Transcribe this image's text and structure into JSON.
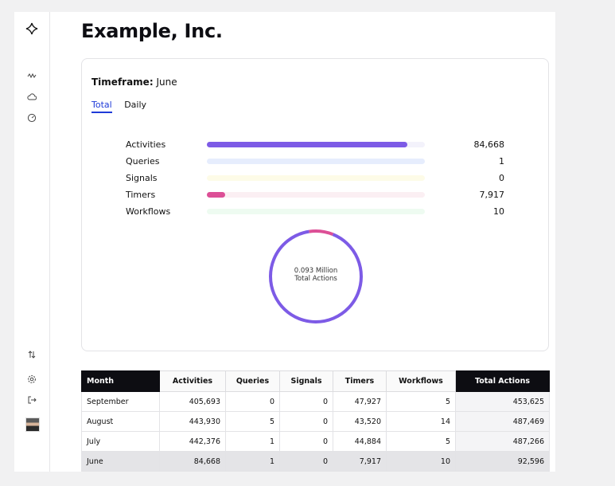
{
  "org": {
    "title": "Example, Inc."
  },
  "sidebar": {
    "icons": [
      "logo-icon",
      "activity-icon",
      "cloud-icon",
      "gauge-icon",
      "sort-icon",
      "settings-icon",
      "logout-icon"
    ]
  },
  "summary": {
    "timeframe_label": "Timeframe:",
    "timeframe_value": "June",
    "tabs": [
      {
        "label": "Total",
        "active": true
      },
      {
        "label": "Daily",
        "active": false
      }
    ],
    "metrics": [
      {
        "label": "Activities",
        "value": "84,668",
        "fraction": 0.92,
        "color": "#7d5be6",
        "track": "#f3f2fb"
      },
      {
        "label": "Queries",
        "value": "1",
        "fraction": 0.0,
        "color": "#9fb8ff",
        "track": "#e6edfd"
      },
      {
        "label": "Signals",
        "value": "0",
        "fraction": 0.0,
        "color": "#f0e08a",
        "track": "#fdfbe7"
      },
      {
        "label": "Timers",
        "value": "7,917",
        "fraction": 0.085,
        "color": "#dc4f96",
        "track": "#fbeff3"
      },
      {
        "label": "Workflows",
        "value": "10",
        "fraction": 0.0,
        "color": "#8fe0a8",
        "track": "#eefbf1"
      }
    ],
    "donut": {
      "line1": "0.093 Million",
      "line2": "Total Actions"
    }
  },
  "table": {
    "headers": [
      "Month",
      "Activities",
      "Queries",
      "Signals",
      "Timers",
      "Workflows",
      "Total Actions"
    ],
    "rows": [
      [
        "September",
        "405,693",
        "0",
        "0",
        "47,927",
        "5",
        "453,625"
      ],
      [
        "August",
        "443,930",
        "5",
        "0",
        "43,520",
        "14",
        "487,469"
      ],
      [
        "July",
        "442,376",
        "1",
        "0",
        "44,884",
        "5",
        "487,266"
      ],
      [
        "June",
        "84,668",
        "1",
        "0",
        "7,917",
        "10",
        "92,596"
      ]
    ],
    "selected_row": 3
  }
}
